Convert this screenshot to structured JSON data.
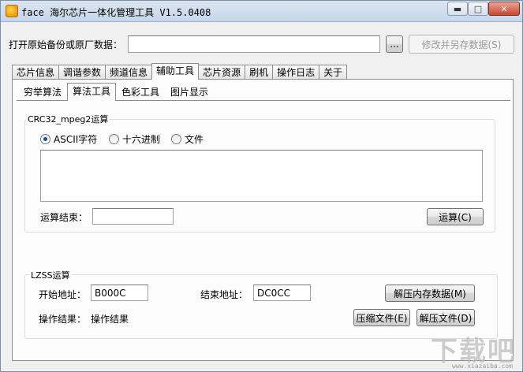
{
  "window": {
    "title": "face 海尔芯片一体化管理工具 V1.5.0408",
    "min_icon": "minimize-icon",
    "max_icon": "maximize-icon",
    "close_icon": "close-icon"
  },
  "file_row": {
    "label": "打开原始备份或原厂数据：",
    "path_value": "",
    "browse_label": "...",
    "save_label": "修改并另存数据(S)"
  },
  "tabs": [
    "芯片信息",
    "调谐参数",
    "频道信息",
    "辅助工具",
    "芯片资源",
    "刷机",
    "操作日志",
    "关于"
  ],
  "active_tab": "辅助工具",
  "subtabs": [
    "穷举算法",
    "算法工具",
    "色彩工具",
    "图片显示"
  ],
  "active_subtab": "算法工具",
  "crc": {
    "title": "CRC32_mpeg2运算",
    "radio_ascii": "ASCII字符",
    "radio_hex": "十六进制",
    "radio_file": "文件",
    "selected": "ASCII字符",
    "input_text": "",
    "result_label": "运算结束：",
    "result_value": "",
    "compute_label": "运算(C)"
  },
  "lzss": {
    "title": "LZSS运算",
    "start_label": "开始地址：",
    "start_value": "B000C",
    "end_label": "结束地址：",
    "end_value": "DC0CC",
    "decompress_mem_label": "解压内存数据(M)",
    "op_result_label": "操作结果：",
    "op_result_value": "操作结果",
    "compress_file_label": "压缩文件(E)",
    "decompress_file_label": "解压文件(D)"
  },
  "watermark": {
    "text": "下载吧",
    "sub": "www.xiazaiba.com"
  }
}
